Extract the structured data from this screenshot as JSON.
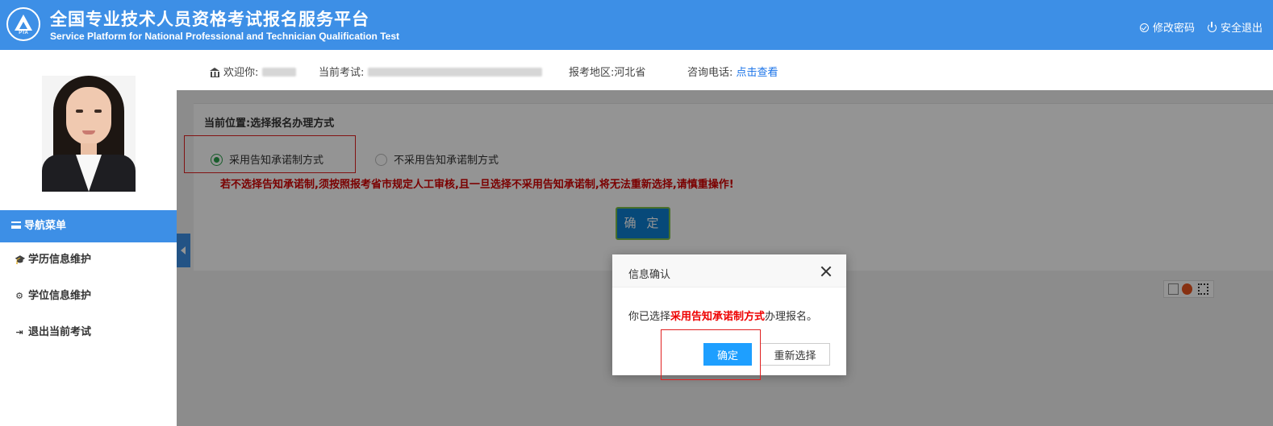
{
  "header": {
    "logo_text": "PTA",
    "title_cn": "全国专业技术人员资格考试报名服务平台",
    "title_en": "Service Platform for National Professional and Technician Qualification Test",
    "change_password": "修改密码",
    "logout": "安全退出"
  },
  "sidebar": {
    "nav_title": "导航菜单",
    "items": [
      {
        "label": "学历信息维护",
        "icon": "graduation-cap-icon"
      },
      {
        "label": "学位信息维护",
        "icon": "medal-icon"
      },
      {
        "label": "退出当前考试",
        "icon": "sign-out-icon"
      }
    ]
  },
  "topbar": {
    "welcome_label": "欢迎你:",
    "current_exam_label": "当前考试:",
    "region_label": "报考地区:",
    "region_value": "河北省",
    "consult_label": "咨询电话:",
    "consult_link": "点击查看"
  },
  "main": {
    "breadcrumb": "当前位置:选择报名办理方式",
    "option_yes": "采用告知承诺制方式",
    "option_no": "不采用告知承诺制方式",
    "selected": "option_yes",
    "warning": "若不选择告知承诺制,须按照报考省市规定人工审核,且一旦选择不采用告知承诺制,将无法重新选择,请慎重操作!",
    "confirm_button": "确 定"
  },
  "dialog": {
    "title": "信息确认",
    "message_prefix": "你已选择",
    "message_highlight": "采用告知承诺制方式",
    "message_suffix": "办理报名。",
    "ok_button": "确定",
    "reselect_button": "重新选择"
  },
  "colors": {
    "brand_blue": "#3d8fe6",
    "warning_red": "#d40000",
    "primary_button": "#1e9fff",
    "radio_green": "#2aa04a"
  }
}
